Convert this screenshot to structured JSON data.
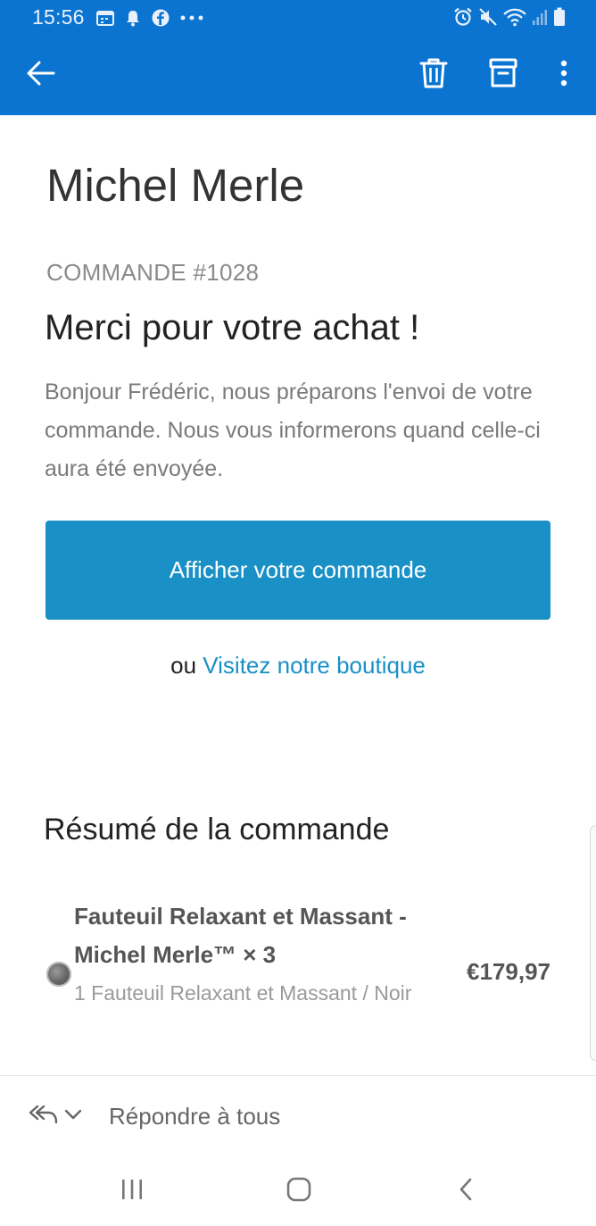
{
  "status_bar": {
    "time": "15:56",
    "left_icons": [
      "calendar-icon",
      "notification-bell-icon",
      "facebook-icon",
      "more-notifications-icon"
    ],
    "right_icons": [
      "alarm-icon",
      "mute-icon",
      "wifi-icon",
      "signal-icon",
      "battery-icon"
    ]
  },
  "app_bar": {
    "background_color": "#0b74d1",
    "back_icon": "arrow-left-icon",
    "actions": [
      "trash-icon",
      "archive-icon",
      "more-vertical-icon"
    ]
  },
  "email": {
    "shop_name": "Michel Merle",
    "order_number": "COMMANDE #1028",
    "thanks_title": "Merci pour votre achat !",
    "thanks_body": "Bonjour Frédéric, nous préparons l'envoi de votre commande. Nous vous informerons quand celle-ci aura été envoyée.",
    "cta_label": "Afficher votre commande",
    "cta_color": "#1990c6",
    "alt_prefix": "ou",
    "alt_link": "Visitez notre boutique",
    "summary_title": "Résumé de la commande",
    "items": [
      {
        "title": "Fauteuil Relaxant et Massant - Michel Merle™ × 3",
        "variant": "1 Fauteuil Relaxant et Massant / Noir",
        "price": "€179,97"
      }
    ]
  },
  "reply_bar": {
    "label": "Répondre à tous",
    "icons": [
      "reply-all-icon",
      "chevron-down-icon"
    ]
  },
  "nav_bar": {
    "buttons": [
      "recent-apps-icon",
      "home-icon",
      "back-icon"
    ]
  }
}
